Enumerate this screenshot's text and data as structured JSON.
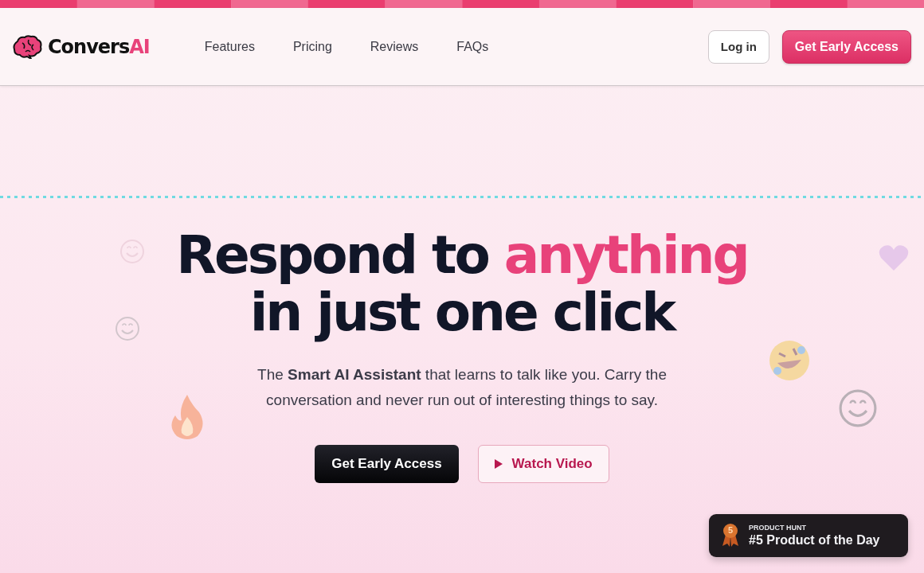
{
  "logo": {
    "name": "Convers",
    "accent": "AI"
  },
  "nav": [
    {
      "label": "Features"
    },
    {
      "label": "Pricing"
    },
    {
      "label": "Reviews"
    },
    {
      "label": "FAQs"
    }
  ],
  "header_actions": {
    "login": "Log in",
    "cta": "Get Early Access"
  },
  "hero": {
    "headline_lead": "Respond to",
    "headline_accent": "anything",
    "headline_line2": "in just one click",
    "subtitle": "The **Smart AI Assistant** that learns to talk like you. Carry the conversation and never run out of interesting things to say.",
    "primary_button": "Get Early Access",
    "video_button": "Watch Video"
  },
  "badge": {
    "rank": "5",
    "eyebrow": "PRODUCT HUNT",
    "title": "#5 Product of the Day"
  }
}
